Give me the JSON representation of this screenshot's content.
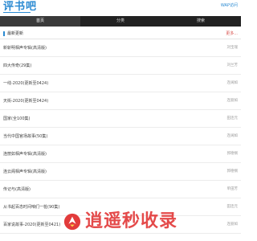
{
  "header": {
    "logo": "评书吧",
    "top_link": "WAP访问"
  },
  "nav": {
    "items": [
      {
        "label": "首页",
        "active": true
      },
      {
        "label": "分类",
        "active": false
      },
      {
        "label": "搜索",
        "active": false
      }
    ]
  },
  "section": {
    "title": "最新更新",
    "more": "更多..."
  },
  "list": [
    {
      "title": "新斩明相声专辑(高清版)",
      "tag": "刘宝瑞"
    },
    {
      "title": "四大传奇(29集)",
      "tag": "刘兰芳"
    },
    {
      "title": "一线-2020(更新至0424)",
      "tag": "连阔如"
    },
    {
      "title": "天街-2020(更新至0424)",
      "tag": "连丽如"
    },
    {
      "title": "国家(全100集)",
      "tag": "田连元"
    },
    {
      "title": "当代中国官场故事(50集)",
      "tag": "连阔如"
    },
    {
      "title": "连丽如相声专辑(高清版)",
      "tag": "郭德纲"
    },
    {
      "title": "连云阁相声专辑(高清版)",
      "tag": "郭德纲"
    },
    {
      "title": "传记与(高清版)",
      "tag": "单田芳"
    },
    {
      "title": "从书起百态时间咱们一桩(90集)",
      "tag": "田连元"
    },
    {
      "title": "百家说故事-2020(更新至0421)",
      "tag": "连丽如"
    }
  ],
  "watermark": {
    "text": "逍遥秒收录"
  },
  "colors": {
    "accent": "#2a8ad2",
    "nav_bg": "#222222",
    "more": "#d9534f",
    "watermark": "#e23b3b"
  }
}
